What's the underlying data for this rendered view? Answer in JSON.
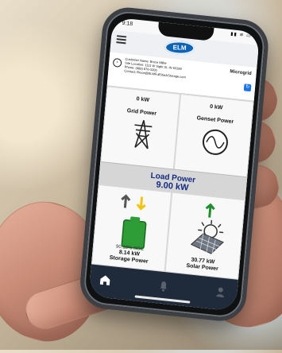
{
  "status": {
    "time": "9:18",
    "icons": "▮▮ ≋ ▭"
  },
  "header": {
    "logo": "ELM",
    "microgrid": "Microgrid"
  },
  "customer": {
    "lines": [
      "Customer Name: Bruce Miller",
      "Site Location: 1111 W Sight St, IN 83199",
      "Phone: (888) 876-3200",
      "Contact: Bruce@ELMFullStackStorage.com"
    ]
  },
  "dashboard": {
    "grid": {
      "value": "0 kW",
      "label": "Grid Power"
    },
    "genset": {
      "value": "0 kW",
      "label": "Genset Power"
    },
    "load": {
      "label": "Load Power",
      "value": "9.00 kW"
    },
    "storage": {
      "value": "8.14 kW",
      "label": "Storage Power",
      "soc": "90.18% SOC"
    },
    "solar": {
      "value": "30.77 kW",
      "label": "Solar Power"
    }
  },
  "colors": {
    "brand_blue": "#0d63b4",
    "load_text": "#132b83",
    "battery_green": "#2e9d37",
    "arrow_green": "#1f8f2e",
    "arrow_yellow": "#f1c40f",
    "nav_dark": "#1f2b3a"
  },
  "icons": {
    "menu": "hamburger-menu-icon",
    "back": "back-arrow-icon",
    "grid": "power-tower-icon",
    "genset": "generator-sine-icon",
    "storage": "battery-icon",
    "solar": "solar-panel-icon",
    "home": "home-icon",
    "alerts": "bell-icon",
    "profile": "user-icon"
  }
}
